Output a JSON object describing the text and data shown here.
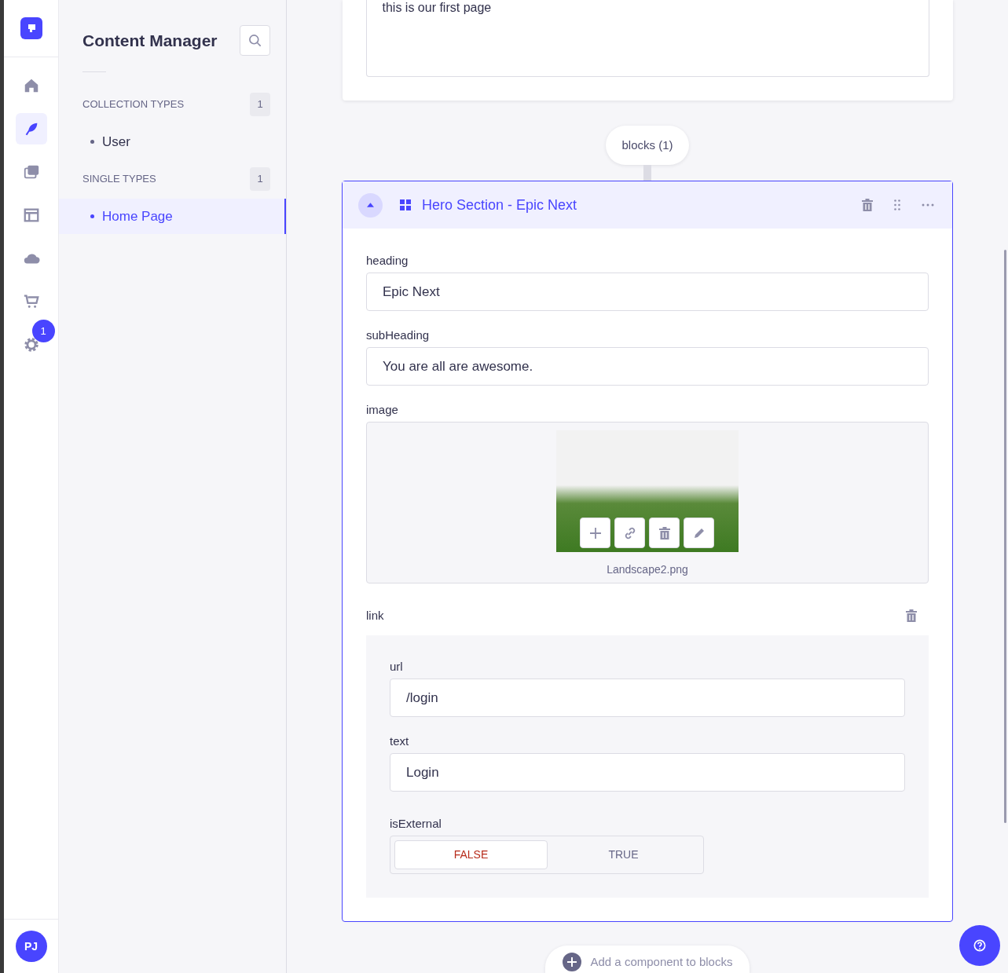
{
  "nav_rail": {
    "items": [
      {
        "kind": "home",
        "selected": false
      },
      {
        "kind": "feather",
        "selected": true
      },
      {
        "kind": "images",
        "selected": false
      },
      {
        "kind": "layout",
        "selected": false
      },
      {
        "kind": "cloud",
        "selected": false
      },
      {
        "kind": "cart",
        "selected": false
      },
      {
        "kind": "gear",
        "selected": false,
        "badge": "1"
      }
    ],
    "avatar": "PJ"
  },
  "sidebar": {
    "title": "Content Manager",
    "sections": [
      {
        "heading": "COLLECTION TYPES",
        "count": "1",
        "items": [
          {
            "label": "User",
            "selected": false
          }
        ]
      },
      {
        "heading": "SINGLE TYPES",
        "count": "1",
        "items": [
          {
            "label": "Home Page",
            "selected": true
          }
        ]
      }
    ]
  },
  "main": {
    "description_value": "this is our first page",
    "blocks_label": "blocks (1)",
    "component": {
      "title": "Hero Section - Epic Next",
      "expanded": true,
      "fields": [
        {
          "label": "heading",
          "value": "Epic Next"
        },
        {
          "label": "subHeading",
          "value": "You are all are awesome."
        }
      ],
      "image": {
        "label": "image",
        "file_name": "Landscape2.png"
      },
      "link": {
        "label": "link",
        "fields": [
          {
            "label": "url",
            "value": "/login"
          },
          {
            "label": "text",
            "value": "Login"
          }
        ],
        "toggle": {
          "label": "isExternal",
          "options": [
            {
              "label": "FALSE",
              "selected": true
            },
            {
              "label": "TRUE",
              "selected": false
            }
          ]
        }
      }
    },
    "add_component": "Add a component to blocks"
  }
}
